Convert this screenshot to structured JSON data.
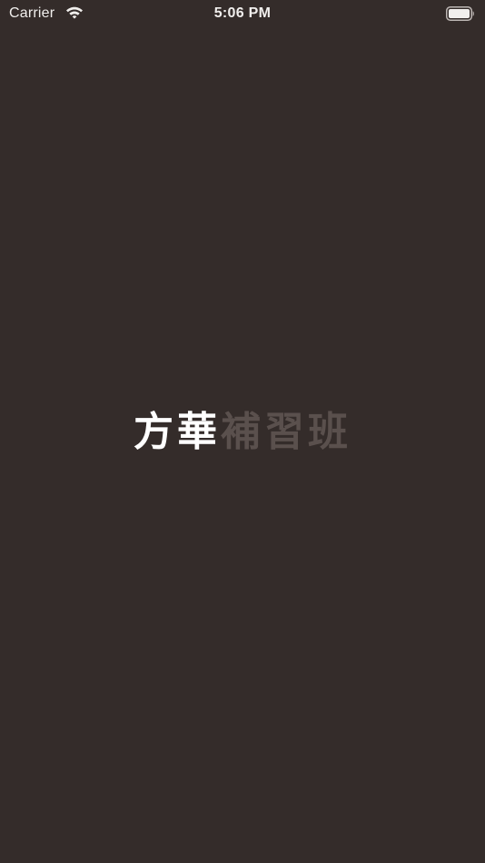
{
  "status_bar": {
    "carrier": "Carrier",
    "time": "5:06 PM",
    "wifi_icon": "wifi-icon",
    "battery_icon": "battery-icon"
  },
  "splash": {
    "title_primary": "方華",
    "title_secondary": "補習班"
  },
  "colors": {
    "background": "#342c2a",
    "title_primary": "#ffffff",
    "title_secondary": "#5a504d",
    "status_text": "#f1efed"
  }
}
